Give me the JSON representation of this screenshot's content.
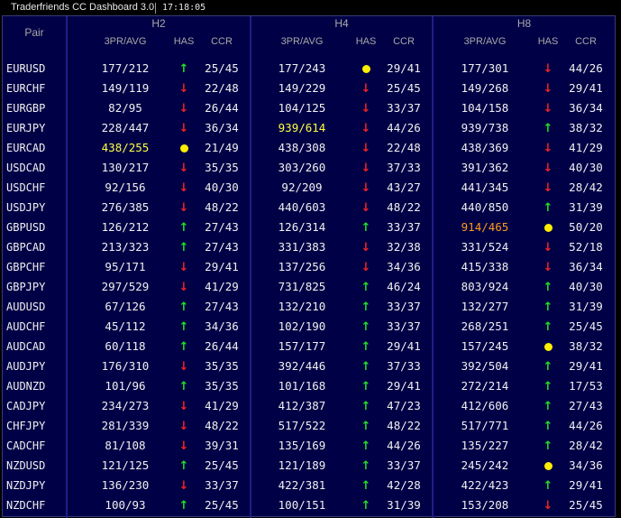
{
  "window": {
    "title": "Traderfriends CC Dashboard 3.0",
    "time": "17:18:05"
  },
  "header": {
    "pair_label": "Pair",
    "timeframes": [
      "H2",
      "H4",
      "H8"
    ],
    "sub_labels": {
      "pr": "3PR/AVG",
      "has": "HAS",
      "ccr": "CCR"
    }
  },
  "colors": {
    "background": "#000046",
    "up": "#22e022",
    "down": "#ee2222",
    "dot": "#ffee00",
    "highlight_yellow": "#ffff44",
    "highlight_orange": "#ff9a1a"
  },
  "rows": [
    {
      "pair": "EURUSD",
      "tf": [
        {
          "pr": "177/212",
          "has": "up",
          "ccr": "25/45"
        },
        {
          "pr": "177/243",
          "has": "dot",
          "ccr": "29/41"
        },
        {
          "pr": "177/301",
          "has": "down",
          "ccr": "44/26"
        }
      ]
    },
    {
      "pair": "EURCHF",
      "tf": [
        {
          "pr": "149/119",
          "has": "down",
          "ccr": "22/48"
        },
        {
          "pr": "149/229",
          "has": "down",
          "ccr": "25/45"
        },
        {
          "pr": "149/268",
          "has": "down",
          "ccr": "29/41"
        }
      ]
    },
    {
      "pair": "EURGBP",
      "tf": [
        {
          "pr": "82/95",
          "has": "down",
          "ccr": "26/44"
        },
        {
          "pr": "104/125",
          "has": "down",
          "ccr": "33/37"
        },
        {
          "pr": "104/158",
          "has": "down",
          "ccr": "36/34"
        }
      ]
    },
    {
      "pair": "EURJPY",
      "tf": [
        {
          "pr": "228/447",
          "has": "down",
          "ccr": "36/34"
        },
        {
          "pr": "939/614",
          "has": "down",
          "ccr": "44/26",
          "hl": "yellow"
        },
        {
          "pr": "939/738",
          "has": "up",
          "ccr": "38/32"
        }
      ]
    },
    {
      "pair": "EURCAD",
      "tf": [
        {
          "pr": "438/255",
          "has": "dot",
          "ccr": "21/49",
          "hl": "yellow"
        },
        {
          "pr": "438/308",
          "has": "down",
          "ccr": "22/48"
        },
        {
          "pr": "438/369",
          "has": "down",
          "ccr": "41/29"
        }
      ]
    },
    {
      "pair": "USDCAD",
      "tf": [
        {
          "pr": "130/217",
          "has": "down",
          "ccr": "35/35"
        },
        {
          "pr": "303/260",
          "has": "down",
          "ccr": "37/33"
        },
        {
          "pr": "391/362",
          "has": "down",
          "ccr": "40/30"
        }
      ]
    },
    {
      "pair": "USDCHF",
      "tf": [
        {
          "pr": "92/156",
          "has": "down",
          "ccr": "40/30"
        },
        {
          "pr": "92/209",
          "has": "down",
          "ccr": "43/27"
        },
        {
          "pr": "441/345",
          "has": "down",
          "ccr": "28/42"
        }
      ]
    },
    {
      "pair": "USDJPY",
      "tf": [
        {
          "pr": "276/385",
          "has": "down",
          "ccr": "48/22"
        },
        {
          "pr": "440/603",
          "has": "down",
          "ccr": "48/22"
        },
        {
          "pr": "440/850",
          "has": "up",
          "ccr": "31/39"
        }
      ]
    },
    {
      "pair": "GBPUSD",
      "tf": [
        {
          "pr": "126/212",
          "has": "up",
          "ccr": "27/43"
        },
        {
          "pr": "126/314",
          "has": "up",
          "ccr": "33/37"
        },
        {
          "pr": "914/465",
          "has": "dot",
          "ccr": "50/20",
          "hl": "orange"
        }
      ]
    },
    {
      "pair": "GBPCAD",
      "tf": [
        {
          "pr": "213/323",
          "has": "up",
          "ccr": "27/43"
        },
        {
          "pr": "331/383",
          "has": "down",
          "ccr": "32/38"
        },
        {
          "pr": "331/524",
          "has": "down",
          "ccr": "52/18"
        }
      ]
    },
    {
      "pair": "GBPCHF",
      "tf": [
        {
          "pr": "95/171",
          "has": "down",
          "ccr": "29/41"
        },
        {
          "pr": "137/256",
          "has": "down",
          "ccr": "34/36"
        },
        {
          "pr": "415/338",
          "has": "down",
          "ccr": "36/34"
        }
      ]
    },
    {
      "pair": "GBPJPY",
      "tf": [
        {
          "pr": "297/529",
          "has": "down",
          "ccr": "41/29"
        },
        {
          "pr": "731/825",
          "has": "up",
          "ccr": "46/24"
        },
        {
          "pr": "803/924",
          "has": "up",
          "ccr": "40/30"
        }
      ]
    },
    {
      "pair": "AUDUSD",
      "tf": [
        {
          "pr": "67/126",
          "has": "up",
          "ccr": "27/43"
        },
        {
          "pr": "132/210",
          "has": "up",
          "ccr": "33/37"
        },
        {
          "pr": "132/277",
          "has": "up",
          "ccr": "31/39"
        }
      ]
    },
    {
      "pair": "AUDCHF",
      "tf": [
        {
          "pr": "45/112",
          "has": "up",
          "ccr": "34/36"
        },
        {
          "pr": "102/190",
          "has": "up",
          "ccr": "33/37"
        },
        {
          "pr": "268/251",
          "has": "up",
          "ccr": "25/45"
        }
      ]
    },
    {
      "pair": "AUDCAD",
      "tf": [
        {
          "pr": "60/118",
          "has": "up",
          "ccr": "26/44"
        },
        {
          "pr": "157/177",
          "has": "up",
          "ccr": "29/41"
        },
        {
          "pr": "157/245",
          "has": "dot",
          "ccr": "38/32"
        }
      ]
    },
    {
      "pair": "AUDJPY",
      "tf": [
        {
          "pr": "176/310",
          "has": "down",
          "ccr": "35/35"
        },
        {
          "pr": "392/446",
          "has": "up",
          "ccr": "37/33"
        },
        {
          "pr": "392/504",
          "has": "up",
          "ccr": "29/41"
        }
      ]
    },
    {
      "pair": "AUDNZD",
      "tf": [
        {
          "pr": "101/96",
          "has": "up",
          "ccr": "35/35"
        },
        {
          "pr": "101/168",
          "has": "up",
          "ccr": "29/41"
        },
        {
          "pr": "272/214",
          "has": "up",
          "ccr": "17/53"
        }
      ]
    },
    {
      "pair": "CADJPY",
      "tf": [
        {
          "pr": "234/273",
          "has": "down",
          "ccr": "41/29"
        },
        {
          "pr": "412/387",
          "has": "up",
          "ccr": "47/23"
        },
        {
          "pr": "412/606",
          "has": "up",
          "ccr": "27/43"
        }
      ]
    },
    {
      "pair": "CHFJPY",
      "tf": [
        {
          "pr": "281/339",
          "has": "down",
          "ccr": "48/22"
        },
        {
          "pr": "517/522",
          "has": "up",
          "ccr": "48/22"
        },
        {
          "pr": "517/771",
          "has": "up",
          "ccr": "44/26"
        }
      ]
    },
    {
      "pair": "CADCHF",
      "tf": [
        {
          "pr": "81/108",
          "has": "down",
          "ccr": "39/31"
        },
        {
          "pr": "135/169",
          "has": "up",
          "ccr": "44/26"
        },
        {
          "pr": "135/227",
          "has": "up",
          "ccr": "28/42"
        }
      ]
    },
    {
      "pair": "NZDUSD",
      "tf": [
        {
          "pr": "121/125",
          "has": "up",
          "ccr": "25/45"
        },
        {
          "pr": "121/189",
          "has": "up",
          "ccr": "33/37"
        },
        {
          "pr": "245/242",
          "has": "dot",
          "ccr": "34/36"
        }
      ]
    },
    {
      "pair": "NZDJPY",
      "tf": [
        {
          "pr": "136/230",
          "has": "down",
          "ccr": "33/37"
        },
        {
          "pr": "422/381",
          "has": "up",
          "ccr": "42/28"
        },
        {
          "pr": "422/423",
          "has": "up",
          "ccr": "29/41"
        }
      ]
    },
    {
      "pair": "NZDCHF",
      "tf": [
        {
          "pr": "100/93",
          "has": "up",
          "ccr": "25/45"
        },
        {
          "pr": "100/151",
          "has": "up",
          "ccr": "31/39"
        },
        {
          "pr": "153/208",
          "has": "down",
          "ccr": "25/45"
        }
      ]
    }
  ]
}
